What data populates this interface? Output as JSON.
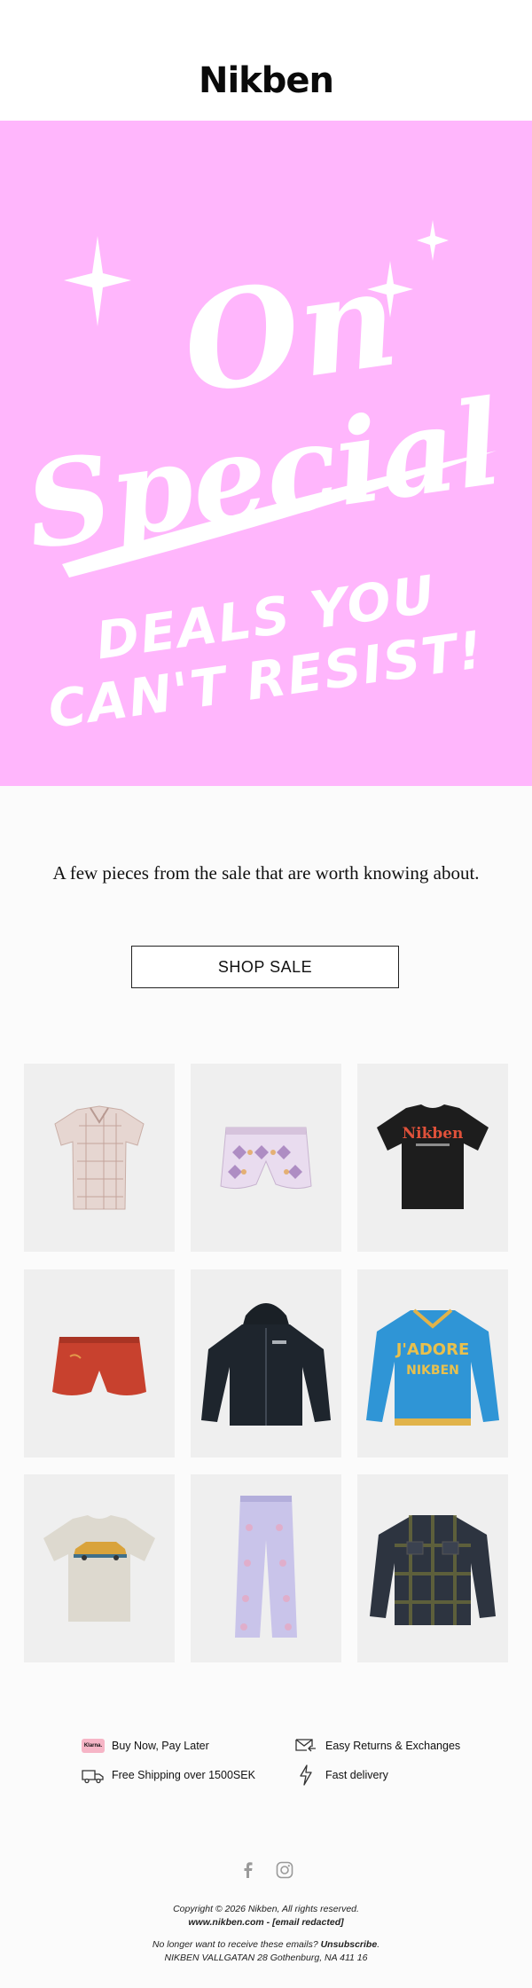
{
  "brand": {
    "logo_text": "Nikben"
  },
  "hero": {
    "line1": "On",
    "line2": "Special",
    "line3": "DEALS YOU",
    "line4": "CAN'T RESIST!",
    "background_color": "#ffb6fc"
  },
  "intro_text": "A few pieces from the sale that are worth knowing about.",
  "cta": {
    "label": "SHOP SALE"
  },
  "products": [
    {
      "name": "patterned-short-sleeve-shirt"
    },
    {
      "name": "diamond-pattern-shorts"
    },
    {
      "name": "black-tshirt",
      "print_text": "Nikben"
    },
    {
      "name": "red-swim-shorts"
    },
    {
      "name": "black-zip-hoodie"
    },
    {
      "name": "blue-varsity-jacket",
      "print_line1": "J'ADORE",
      "print_line2": "NIKBEN"
    },
    {
      "name": "beige-car-print-tshirt"
    },
    {
      "name": "lilac-pattern-trousers"
    },
    {
      "name": "dark-check-overshirt"
    }
  ],
  "benefits": {
    "klarna_badge": "Klarna.",
    "bnpl": "Buy Now, Pay Later",
    "returns": "Easy Returns & Exchanges",
    "shipping": "Free Shipping over 1500SEK",
    "delivery": "Fast delivery"
  },
  "social": {
    "facebook": "facebook-icon",
    "instagram": "instagram-icon"
  },
  "footer": {
    "copyright": "Copyright © 2026 Nikben, All rights reserved.",
    "site_line": "www.nikben.com - [email redacted]",
    "unsub_prefix": "No longer want to receive these emails? ",
    "unsub_link": "Unsubscribe",
    "unsub_suffix": ".",
    "address": "NIKBEN VALLGATAN 28 Gothenburg, NA 411 16"
  }
}
